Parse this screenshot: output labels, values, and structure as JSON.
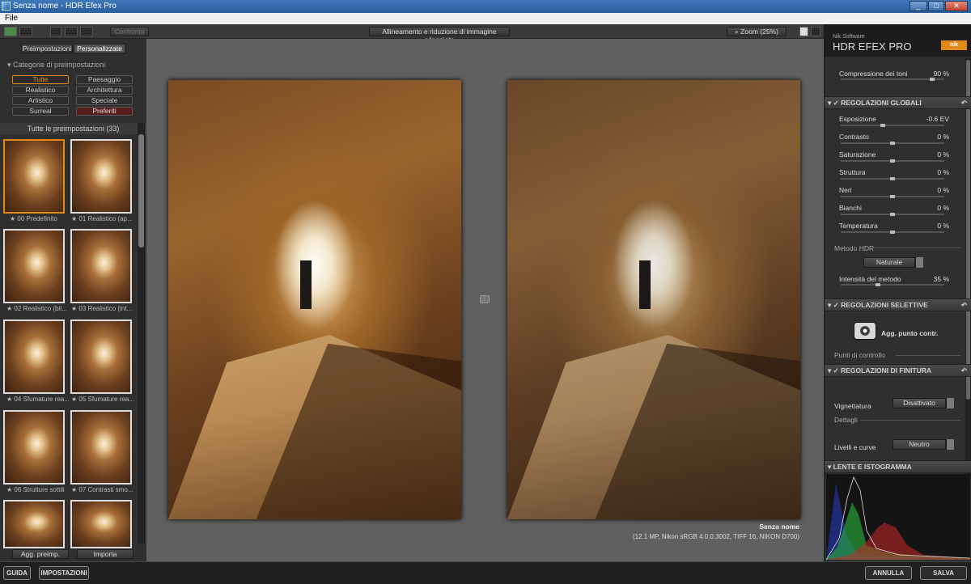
{
  "window": {
    "title": "Senza nome - HDR Efex Pro",
    "controls": [
      "_",
      "□",
      "✕"
    ]
  },
  "menu": {
    "file": "File"
  },
  "toolbar": {
    "compare_btn": "Confronta",
    "center_label": "Allineamento e riduzione di immagine sdoppiata",
    "zoom": "Zoom (25%)"
  },
  "left": {
    "tabs": [
      "Preimpostazioni",
      "Personalizzate"
    ],
    "categories_title": "Categorie di preimpostazioni",
    "categories": [
      "Tutte",
      "Paesaggio",
      "Realistico",
      "Architettura",
      "Artistico",
      "Speciale",
      "Surreal",
      "Preferiti"
    ],
    "all_presets": "Tutte le preimpostazioni (33)",
    "presets": [
      "00 Predefinito",
      "01 Realistico (ap...",
      "02 Realistico (bil...",
      "03 Realistico (int...",
      "04 Sfumature rea...",
      "05 Sfumature rea...",
      "06 Strutture sottili",
      "07 Contrasti smo...",
      "",
      ""
    ],
    "add_btn": "Agg. preimp.",
    "import_btn": "Importa"
  },
  "canvas": {
    "filename": "Senza nome",
    "fileinfo": "(12.1 MP, Nikon sRGB 4.0.0.3002, TIFF 16, NIKON D700)"
  },
  "right": {
    "brand_small": "Nik Software",
    "brand": "HDR EFEX PRO",
    "logo_text": "nik",
    "tone_comp": {
      "label": "Compressione dei toni",
      "value": "90",
      "unit": "%",
      "pct": 0.9
    },
    "global": {
      "title": "REGOLAZIONI GLOBALI",
      "sliders": [
        {
          "label": "Esposizione",
          "value": "-0.6",
          "unit": "EV",
          "pct": 0.4
        },
        {
          "label": "Contrasto",
          "value": "0",
          "unit": "%",
          "pct": 0.5
        },
        {
          "label": "Saturazione",
          "value": "0",
          "unit": "%",
          "pct": 0.5
        },
        {
          "label": "Struttura",
          "value": "0",
          "unit": "%",
          "pct": 0.5
        },
        {
          "label": "Neri",
          "value": "0",
          "unit": "%",
          "pct": 0.5
        },
        {
          "label": "Bianchi",
          "value": "0",
          "unit": "%",
          "pct": 0.5
        },
        {
          "label": "Temperatura",
          "value": "0",
          "unit": "%",
          "pct": 0.5
        }
      ]
    },
    "method": {
      "label": "Metodo HDR",
      "dropdown": "Naturale",
      "intensity_label": "Intensità del metodo",
      "intensity_value": "35",
      "intensity_unit": "%",
      "intensity_pct": 0.35
    },
    "selective": {
      "title": "REGOLAZIONI SELETTIVE",
      "add_point": "Agg. punto contr.",
      "control_points": "Punti di controllo"
    },
    "finishing": {
      "title": "REGOLAZIONI DI FINITURA",
      "vignette_label": "Vignettatura",
      "vignette_value": "Disattivato",
      "details": "Dettagli",
      "levels_label": "Livelli e curve",
      "levels_value": "Neutro"
    },
    "histogram": {
      "title": "LENTE E ISTOGRAMMA"
    }
  },
  "bottom": {
    "help": "GUIDA",
    "settings": "IMPOSTAZIONI",
    "cancel": "ANNULLA",
    "save": "SALVA"
  },
  "colors": {
    "accent_orange": "#e08a18",
    "panel": "#2f2f2f",
    "canvas": "#606060"
  }
}
